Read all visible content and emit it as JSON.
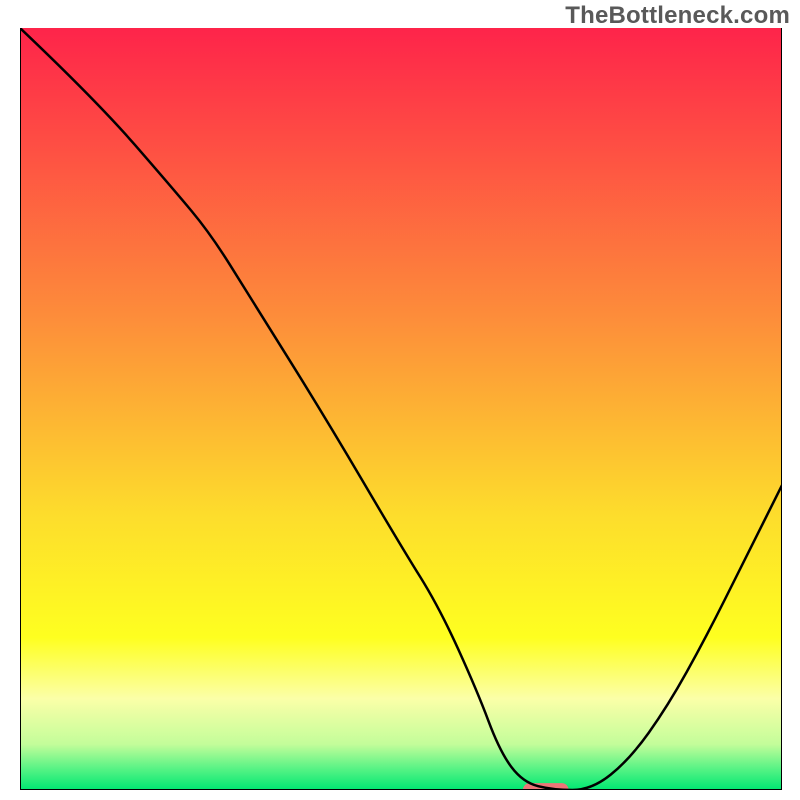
{
  "watermark": "TheBottleneck.com",
  "chart_data": {
    "type": "line",
    "title": "",
    "xlabel": "",
    "ylabel": "",
    "xlim": [
      0,
      100
    ],
    "ylim": [
      0,
      100
    ],
    "grid": false,
    "legend": false,
    "background_gradient": {
      "stops": [
        {
          "offset": 0.0,
          "color": "#fe244a"
        },
        {
          "offset": 0.38,
          "color": "#fd8d3a"
        },
        {
          "offset": 0.64,
          "color": "#fddd2c"
        },
        {
          "offset": 0.8,
          "color": "#feff20"
        },
        {
          "offset": 0.88,
          "color": "#fbffa8"
        },
        {
          "offset": 0.94,
          "color": "#c3fd9a"
        },
        {
          "offset": 0.975,
          "color": "#4ef283"
        },
        {
          "offset": 1.0,
          "color": "#00e772"
        }
      ]
    },
    "series": [
      {
        "name": "bottleneck-curve",
        "color": "#000000",
        "x": [
          0,
          10,
          20,
          25,
          30,
          40,
          50,
          55,
          60,
          63,
          66,
          70,
          75,
          80,
          85,
          90,
          95,
          100
        ],
        "y": [
          100,
          90.5,
          79,
          73,
          65,
          49,
          32,
          24,
          13,
          5,
          1,
          0,
          0,
          4,
          11,
          20,
          30,
          40
        ]
      }
    ],
    "marker": {
      "name": "optimal-marker",
      "shape": "capsule",
      "color": "#ec7577",
      "x": 69,
      "y": 0,
      "width_pct": 6,
      "height_pct": 1.8
    },
    "frame": {
      "left": true,
      "right": true,
      "top": false,
      "bottom": true,
      "color": "#000000",
      "width": 2
    }
  }
}
